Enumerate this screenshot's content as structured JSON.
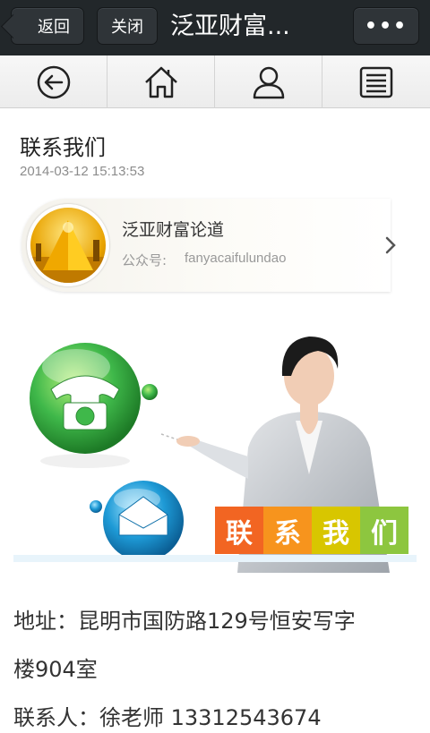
{
  "header": {
    "back_label": "返回",
    "close_label": "关闭",
    "title": "泛亚财富...",
    "more_label": "•••"
  },
  "nav": {
    "items": [
      {
        "icon": "back-circle-icon"
      },
      {
        "icon": "home-icon"
      },
      {
        "icon": "user-icon"
      },
      {
        "icon": "list-icon"
      }
    ]
  },
  "article": {
    "title": "联系我们",
    "date": "2014-03-12 15:13:53"
  },
  "account_card": {
    "name": "泛亚财富论道",
    "id_label": "公众号:",
    "id_value": "fanyacaifulundao"
  },
  "banner": {
    "words": [
      "联",
      "系",
      "我",
      "们"
    ],
    "colors": [
      "#f26522",
      "#f7941d",
      "#d8c600",
      "#8dc63f"
    ]
  },
  "content": {
    "address_line1": "地址：昆明市国防路129号恒安写字",
    "address_line2": "楼904室",
    "contact_line": "联系人：徐老师  13312543674"
  },
  "colors": {
    "titlebar": "#22272a",
    "phone_green": "#3fb84a",
    "mail_blue": "#1e9ad6"
  }
}
